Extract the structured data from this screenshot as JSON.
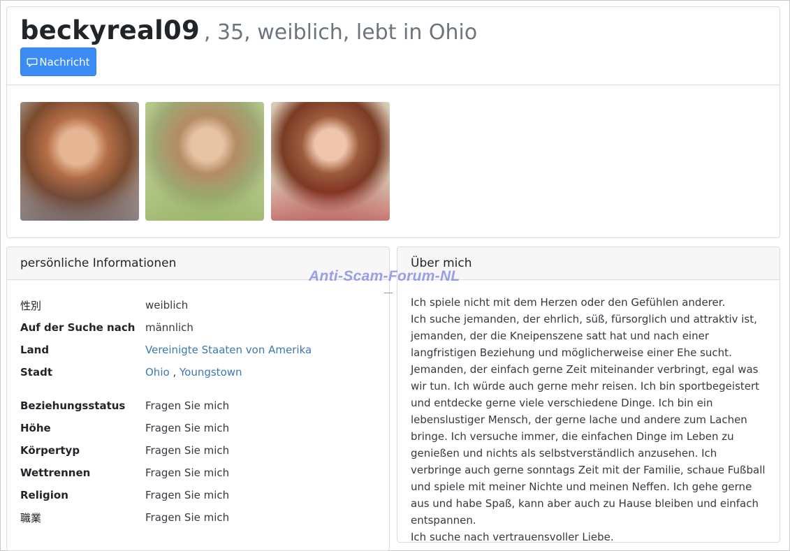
{
  "profile": {
    "username": "beckyreal09",
    "subtitle": ", 35, weiblich, lebt in Ohio",
    "message_button": "Nachricht"
  },
  "photos": [
    {
      "name": "profile-photo-1"
    },
    {
      "name": "profile-photo-2"
    },
    {
      "name": "profile-photo-3"
    }
  ],
  "personal": {
    "heading": "persönliche Informationen",
    "gender_label": "性別",
    "gender_value": "weiblich",
    "seeking_label": "Auf der Suche nach",
    "seeking_value": "männlich",
    "country_label": "Land",
    "country_value": "Vereinigte Staaten von Amerika",
    "city_label": "Stadt",
    "city_state": "Ohio",
    "city_sep": " , ",
    "city_name": "Youngstown",
    "relationship_label": "Beziehungsstatus",
    "relationship_value": "Fragen Sie mich",
    "height_label": "Höhe",
    "height_value": "Fragen Sie mich",
    "bodytype_label": "Körpertyp",
    "bodytype_value": "Fragen Sie mich",
    "race_label": "Wettrennen",
    "race_value": "Fragen Sie mich",
    "religion_label": "Religion",
    "religion_value": "Fragen Sie mich",
    "occupation_label": "職業",
    "occupation_value": "Fragen Sie mich"
  },
  "about": {
    "heading": "Über mich",
    "line1": "Ich spiele nicht mit dem Herzen oder den Gefühlen anderer.",
    "body": "Ich suche jemanden, der ehrlich, süß, fürsorglich und attraktiv ist, jemanden, der die Kneipenszene satt hat und nach einer langfristigen Beziehung und möglicherweise einer Ehe sucht. Jemanden, der einfach gerne Zeit miteinander verbringt, egal was wir tun. Ich würde auch gerne mehr reisen. Ich bin sportbegeistert und entdecke gerne viele verschiedene Dinge. Ich bin ein lebenslustiger Mensch, der gerne lache und andere zum Lachen bringe. Ich versuche immer, die einfachen Dinge im Leben zu genießen und nichts als selbstverständlich anzusehen. Ich verbringe auch gerne sonntags Zeit mit der Familie, schaue Fußball und spiele mit meiner Nichte und meinen Neffen. Ich gehe gerne aus und habe Spaß, kann aber auch zu Hause bleiben und einfach entspannen.",
    "last_line": "Ich suche nach vertrauensvoller Liebe."
  },
  "watermark": "Anti-Scam-Forum-NL",
  "colors": {
    "primary_button": "#3b8cf5",
    "link": "#3a78b5",
    "watermark": "#7882e6"
  },
  "icons": {
    "message": "chat-bubble-icon"
  }
}
